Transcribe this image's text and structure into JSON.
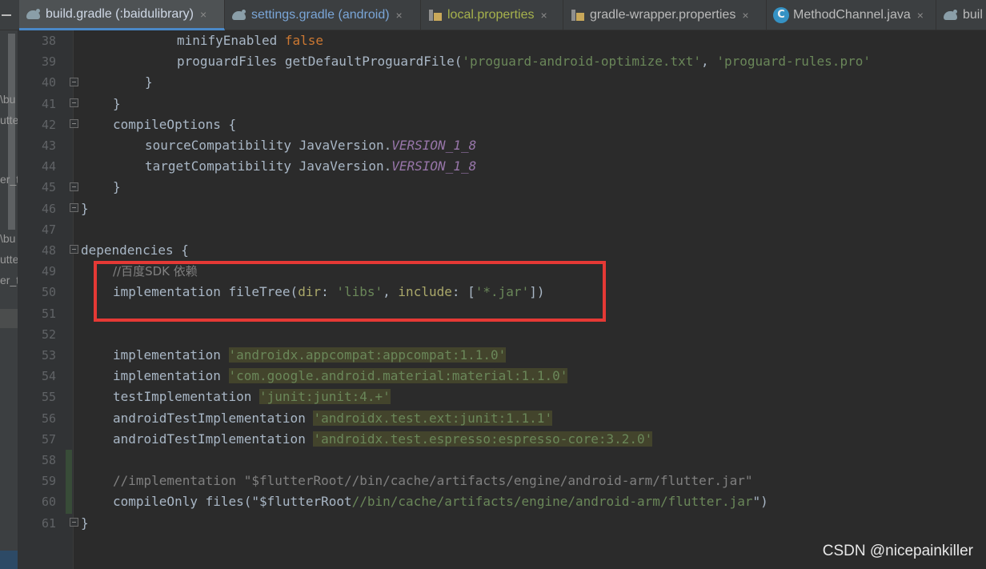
{
  "tabs": [
    {
      "label": "build.gradle (:baidulibrary)",
      "icon": "gradle-icon",
      "active": true
    },
    {
      "label": "settings.gradle (android)",
      "icon": "gradle-icon"
    },
    {
      "label": "local.properties",
      "icon": "properties-file-icon"
    },
    {
      "label": "gradle-wrapper.properties",
      "icon": "properties-file-icon"
    },
    {
      "label": "MethodChannel.java",
      "icon": "java-class-icon"
    },
    {
      "label": "buil",
      "icon": "gradle-icon"
    }
  ],
  "tab_close_glyph": "×",
  "left_panel_fragments": [
    "\\bu",
    "utte",
    "er_t",
    "\\bu",
    "utte",
    "er_t"
  ],
  "line_numbers": [
    "38",
    "39",
    "40",
    "41",
    "42",
    "43",
    "44",
    "45",
    "46",
    "47",
    "48",
    "49",
    "50",
    "51",
    "52",
    "53",
    "54",
    "55",
    "56",
    "57",
    "58",
    "59",
    "60",
    "61"
  ],
  "code": {
    "l38": {
      "a": "minifyEnabled ",
      "b": "false"
    },
    "l39": {
      "a": "proguardFiles getDefaultProguardFile(",
      "b": "'proguard-android-optimize.txt'",
      "c": ", ",
      "d": "'proguard-rules.pro'"
    },
    "l40": "}",
    "l41": "}",
    "l42": "compileOptions {",
    "l43": {
      "a": "sourceCompatibility JavaVersion.",
      "b": "VERSION_1_8"
    },
    "l44": {
      "a": "targetCompatibility JavaVersion.",
      "b": "VERSION_1_8"
    },
    "l45": "}",
    "l46": "}",
    "l48": "dependencies {",
    "l49": "//百度SDK 依赖",
    "l50": {
      "a": "implementation fileTree(",
      "b": "dir",
      "c": ": ",
      "d": "'libs'",
      "e": ", ",
      "f": "include",
      "g": ": [",
      "h": "'*.jar'",
      "i": "])"
    },
    "l53": {
      "a": "implementation ",
      "b": "'androidx.appcompat:appcompat:1.1.0'"
    },
    "l54": {
      "a": "implementation ",
      "b": "'com.google.android.material:material:1.1.0'"
    },
    "l55": {
      "a": "testImplementation ",
      "b": "'junit:junit:4.+'"
    },
    "l56": {
      "a": "androidTestImplementation ",
      "b": "'androidx.test.ext:junit:1.1.1'"
    },
    "l57": {
      "a": "androidTestImplementation ",
      "b": "'androidx.test.espresso:espresso-core:3.2.0'"
    },
    "l59": "//implementation \"$flutterRoot//bin/cache/artifacts/engine/android-arm/flutter.jar\"",
    "l60": {
      "a": "compileOnly files(\"$flutterRoot",
      "b": "//bin/cache/artifacts/engine/android-arm/flutter.jar",
      "c": "\")"
    },
    "l61": "}"
  },
  "watermark": "CSDN @nicepainkiller",
  "colors": {
    "keyword": "#cc7832",
    "string": "#6a8759",
    "comment": "#808080",
    "field": "#9876aa",
    "highlight_box": "#e53935"
  }
}
